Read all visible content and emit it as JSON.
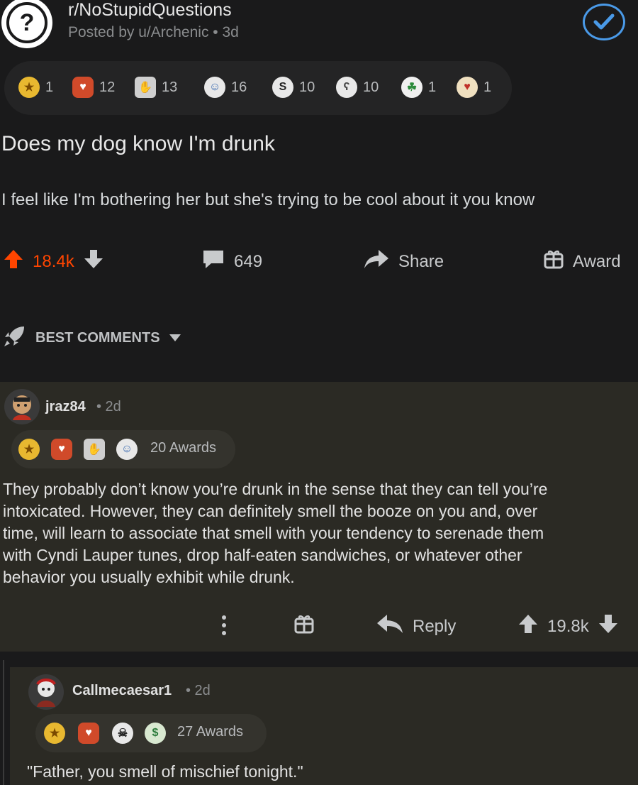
{
  "post": {
    "subreddit": "r/NoStupidQuestions",
    "posted_by": "Posted by u/Archenic • 3d",
    "awards": [
      {
        "icon": "gold-award-icon",
        "count": "1"
      },
      {
        "icon": "wholesome-award-icon",
        "count": "12"
      },
      {
        "icon": "bravo-award-icon",
        "count": "13"
      },
      {
        "icon": "tears-of-joy-award-icon",
        "count": "16"
      },
      {
        "icon": "silver-award-icon",
        "count": "10"
      },
      {
        "icon": "hugz-award-icon",
        "count": "10"
      },
      {
        "icon": "helpful-award-icon",
        "count": "1"
      },
      {
        "icon": "heart-eyes-award-icon",
        "count": "1"
      }
    ],
    "title": "Does my dog know I'm drunk",
    "body": "I feel like I'm bothering her but she's trying to be cool about it you know",
    "votes": "18.4k",
    "comments": "649",
    "share_label": "Share",
    "award_label": "Award"
  },
  "sort": {
    "label": "BEST COMMENTS"
  },
  "comments": [
    {
      "user": "jraz84",
      "time": "• 2d",
      "awards_label": "20 Awards",
      "text_lines": [
        "They probably don’t know you’re drunk in the sense that they can tell you’re",
        "intoxicated. However, they can definitely smell the booze on you and, over",
        "time, will learn to associate that smell with your tendency to serenade them",
        "with Cyndi Lauper tunes, drop half-eaten sandwiches, or whatever other",
        "behavior you usually exhibit while drunk."
      ],
      "reply_label": "Reply",
      "votes": "19.8k"
    },
    {
      "user": "Callmecaesar1",
      "time": "• 2d",
      "awards_label": "27 Awards",
      "text": "\"Father, you smell of mischief tonight.\""
    }
  ],
  "colors": {
    "background": "#1a1a1b",
    "comment_bg": "#2b2a24",
    "upvote": "#ff4500",
    "mod_blue": "#4a9ae8"
  }
}
